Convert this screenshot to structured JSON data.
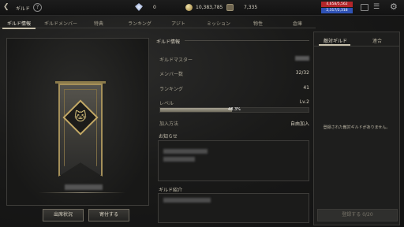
{
  "topbar": {
    "title": "ギルド",
    "help": "?",
    "gem_value": "0",
    "gold_value": "10,383,785",
    "medal_value": "7,335",
    "hp_text": "4,658/5,562",
    "mp_text": "2,317/2,318",
    "icons": [
      "back-icon",
      "help-icon",
      "gem-icon",
      "gold-coin-icon",
      "medal-icon",
      "mail-icon",
      "menu-icon",
      "settings-icon"
    ]
  },
  "tabs": [
    {
      "label": "ギルド情報",
      "active": true
    },
    {
      "label": "ギルドメンバー"
    },
    {
      "label": "特典"
    },
    {
      "label": "ランキング"
    },
    {
      "label": "アジト"
    },
    {
      "label": "ミッション"
    },
    {
      "label": "物性"
    },
    {
      "label": "倉庫"
    }
  ],
  "emblem": {
    "buttons": {
      "attendance": "出席状況",
      "donate": "寄付する"
    }
  },
  "info": {
    "header": "ギルド情報",
    "master_label": "ギルドマスター",
    "members_label": "メンバー数",
    "members_value": "32/32",
    "ranking_label": "ランキング",
    "ranking_value": "41",
    "level_label": "レベル",
    "level_value": "Lv.2",
    "level_progress_text": "48.3%",
    "level_progress": 0.483,
    "join_label": "加入方法",
    "join_value": "自由加入",
    "notice_label": "お知らせ",
    "intro_label": "ギルド紹介"
  },
  "right_panel": {
    "tab_hostile": "敵対ギルド",
    "tab_alliance": "連合",
    "empty_text": "登録された敵対ギルドがありません。",
    "register_button": "登録する 0/20"
  }
}
